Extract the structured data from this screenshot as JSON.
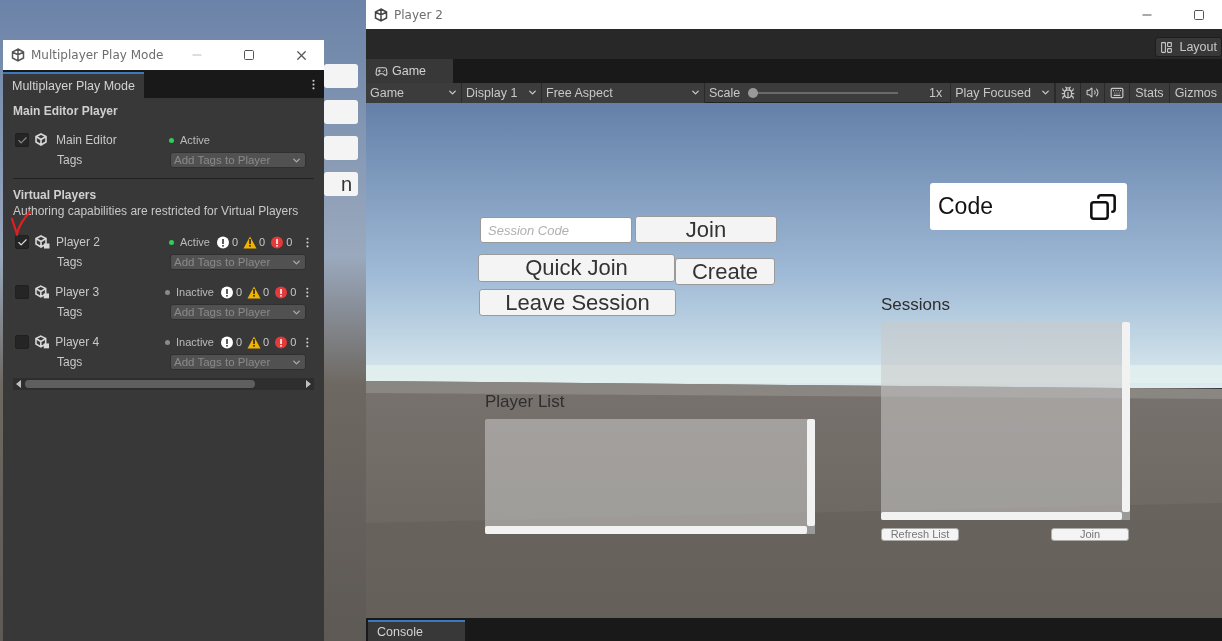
{
  "background_editor": {
    "fragment": "n"
  },
  "multiplayer_window": {
    "title": "Multiplayer Play Mode",
    "tab": "Multiplayer Play Mode",
    "main_section": {
      "heading": "Main Editor Player",
      "players": [
        {
          "kind": "editor",
          "name": "Main Editor",
          "checked": true,
          "disabled": true,
          "status": "Active",
          "active": true,
          "tags_label": "Tags",
          "tags_placeholder": "Add Tags to Player"
        }
      ]
    },
    "virtual_section": {
      "heading": "Virtual Players",
      "note": "Authoring capabilities are restricted for Virtual Players",
      "players": [
        {
          "kind": "virtual",
          "name": "Player 2",
          "checked": true,
          "status": "Active",
          "active": true,
          "info": "0",
          "warnings": "0",
          "errors": "0",
          "tags_label": "Tags",
          "tags_placeholder": "Add Tags to Player"
        },
        {
          "kind": "virtual",
          "name": "Player 3",
          "checked": false,
          "status": "Inactive",
          "active": false,
          "info": "0",
          "warnings": "0",
          "errors": "0",
          "tags_label": "Tags",
          "tags_placeholder": "Add Tags to Player"
        },
        {
          "kind": "virtual",
          "name": "Player 4",
          "checked": false,
          "status": "Inactive",
          "active": false,
          "info": "0",
          "warnings": "0",
          "errors": "0",
          "tags_label": "Tags",
          "tags_placeholder": "Add Tags to Player"
        }
      ]
    }
  },
  "player_window": {
    "title": "Player 2",
    "layout_button": "Layout",
    "tab": "Game",
    "toolbar": {
      "view": "Game",
      "display": "Display 1",
      "aspect": "Free Aspect",
      "scale_label": "Scale",
      "scale": {
        "level": 0
      },
      "scale_value": "1x",
      "play_mode": "Play Focused",
      "stats": "Stats",
      "gizmos": "Gizmos"
    },
    "game_ui": {
      "session_code_placeholder": "Session Code",
      "join": "Join",
      "create": "Create",
      "quick_join": "Quick Join",
      "leave": "Leave Session",
      "code_label": "Code",
      "sessions_title": "Sessions",
      "player_list_title": "Player List",
      "refresh": "Refresh List",
      "join_session": "Join"
    },
    "console_tab": "Console"
  }
}
